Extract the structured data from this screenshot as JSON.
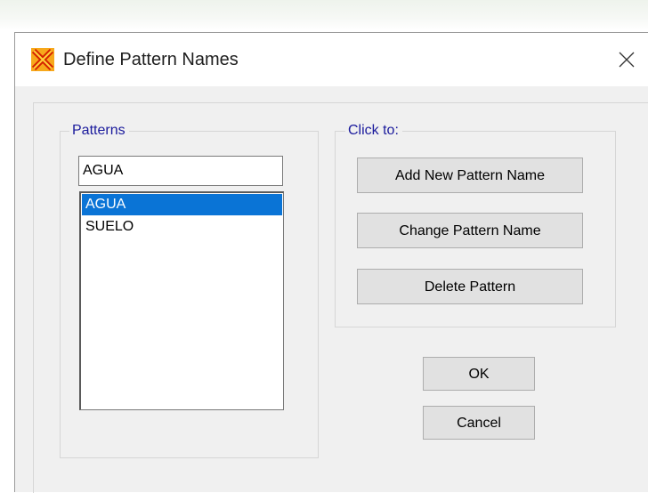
{
  "window": {
    "title": "Define Pattern Names"
  },
  "patterns": {
    "group_label": "Patterns",
    "name_value": "AGUA",
    "items": [
      {
        "label": "AGUA",
        "selected": true
      },
      {
        "label": "SUELO",
        "selected": false
      }
    ]
  },
  "actions": {
    "group_label": "Click to:",
    "add_label": "Add New Pattern Name",
    "change_label": "Change Pattern Name",
    "delete_label": "Delete Pattern"
  },
  "dialog_buttons": {
    "ok_label": "OK",
    "cancel_label": "Cancel"
  },
  "colors": {
    "selection": "#0a74d6",
    "group_label": "#1a1a9c",
    "button_face": "#e1e1e1"
  }
}
